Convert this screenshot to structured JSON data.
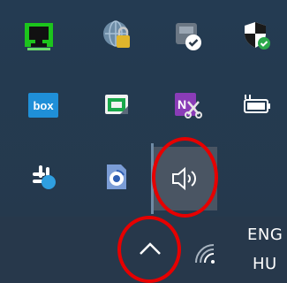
{
  "tray": {
    "icons": [
      {
        "name": "monitor-app-icon",
        "icon": "green-monitor"
      },
      {
        "name": "network-drive-icon",
        "icon": "network-lock"
      },
      {
        "name": "backup-app-icon",
        "icon": "backup-check"
      },
      {
        "name": "shield-check-icon",
        "icon": "shield"
      },
      {
        "name": "box-app-icon",
        "icon": "box",
        "label": "box"
      },
      {
        "name": "snip-sketch-icon",
        "icon": "snip"
      },
      {
        "name": "onenote-send-icon",
        "icon": "onenote-clip",
        "label": "N"
      },
      {
        "name": "battery-icon",
        "icon": "battery"
      },
      {
        "name": "slack-icon",
        "icon": "slack"
      },
      {
        "name": "sync-app-icon",
        "icon": "sync"
      },
      {
        "name": "volume-icon",
        "icon": "speaker"
      }
    ]
  },
  "taskbar": {
    "show_hidden_icons": "^",
    "network": "wifi",
    "language_top": "ENG",
    "language_bottom": "HU"
  },
  "annotations": {
    "highlight_color": "#e60000"
  }
}
